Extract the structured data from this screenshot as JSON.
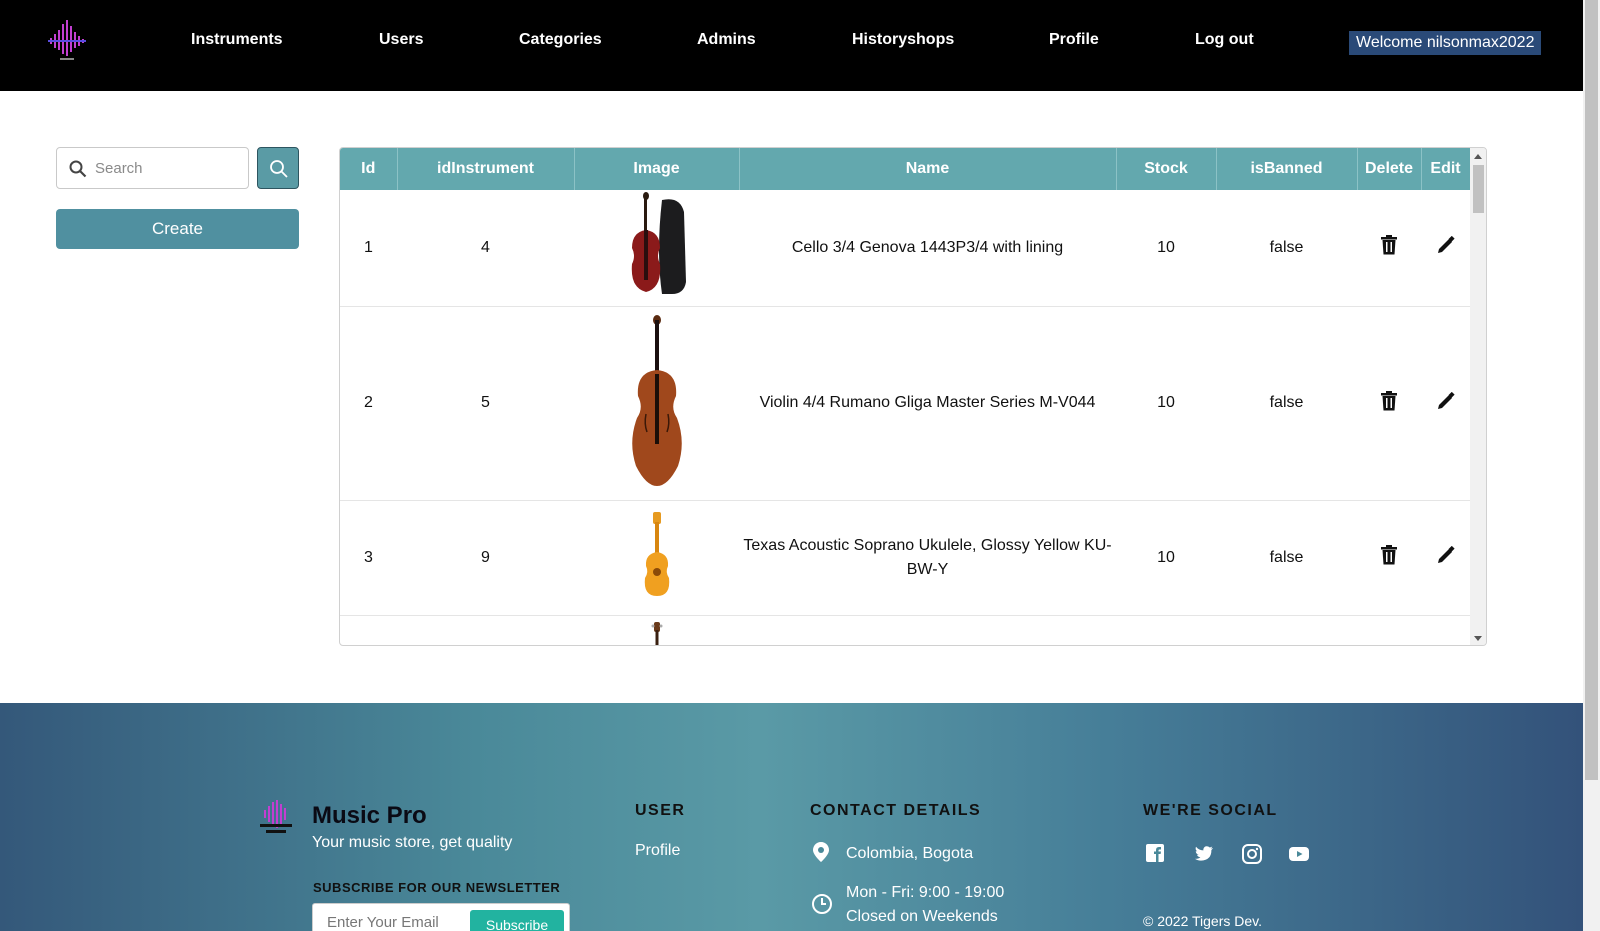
{
  "nav": {
    "links": [
      "Instruments",
      "Users",
      "Categories",
      "Admins",
      "Historyshops",
      "Profile",
      "Log out"
    ],
    "welcome": "Welcome nilsonmax2022"
  },
  "sidebar": {
    "search_placeholder": "Search",
    "create_label": "Create"
  },
  "table": {
    "headers": [
      "Id",
      "idInstrument",
      "Image",
      "Name",
      "Stock",
      "isBanned",
      "Delete",
      "Edit"
    ],
    "rows": [
      {
        "id": "1",
        "idInstrument": "4",
        "image": "cello",
        "name": "Cello 3/4 Genova 1443P3/4 with lining",
        "stock": "10",
        "isBanned": "false"
      },
      {
        "id": "2",
        "idInstrument": "5",
        "image": "violin",
        "name": "Violin 4/4 Rumano Gliga Master Series M-V044",
        "stock": "10",
        "isBanned": "false"
      },
      {
        "id": "3",
        "idInstrument": "9",
        "image": "ukulele",
        "name": "Texas Acoustic Soprano Ukulele, Glossy Yellow KU-BW-Y",
        "stock": "10",
        "isBanned": "false"
      },
      {
        "id": "",
        "idInstrument": "",
        "image": "guitar",
        "name": "",
        "stock": "",
        "isBanned": ""
      }
    ]
  },
  "footer": {
    "brand": "Music Pro",
    "tagline": "Your music store, get quality",
    "newsletter_title": "SUBSCRIBE FOR OUR NEWSLETTER",
    "email_placeholder": "Enter Your Email",
    "subscribe_label": "Subscribe",
    "user_heading": "USER",
    "user_link": "Profile",
    "contact_heading": "CONTACT DETAILS",
    "location": "Colombia, Bogota",
    "hours_line1": "Mon - Fri: 9:00 - 19:00",
    "hours_line2": "Closed on Weekends",
    "social_heading": "WE'RE SOCIAL",
    "social_icons": [
      "facebook-icon",
      "twitter-icon",
      "instagram-icon",
      "youtube-icon"
    ],
    "copyright": "© 2022 Tigers Dev."
  },
  "colors": {
    "navbar": "#000000",
    "table_header": "#63a8ae",
    "accent_button": "#5090a0",
    "welcome_badge": "#2a4a78",
    "subscribe": "#22b3a0"
  }
}
